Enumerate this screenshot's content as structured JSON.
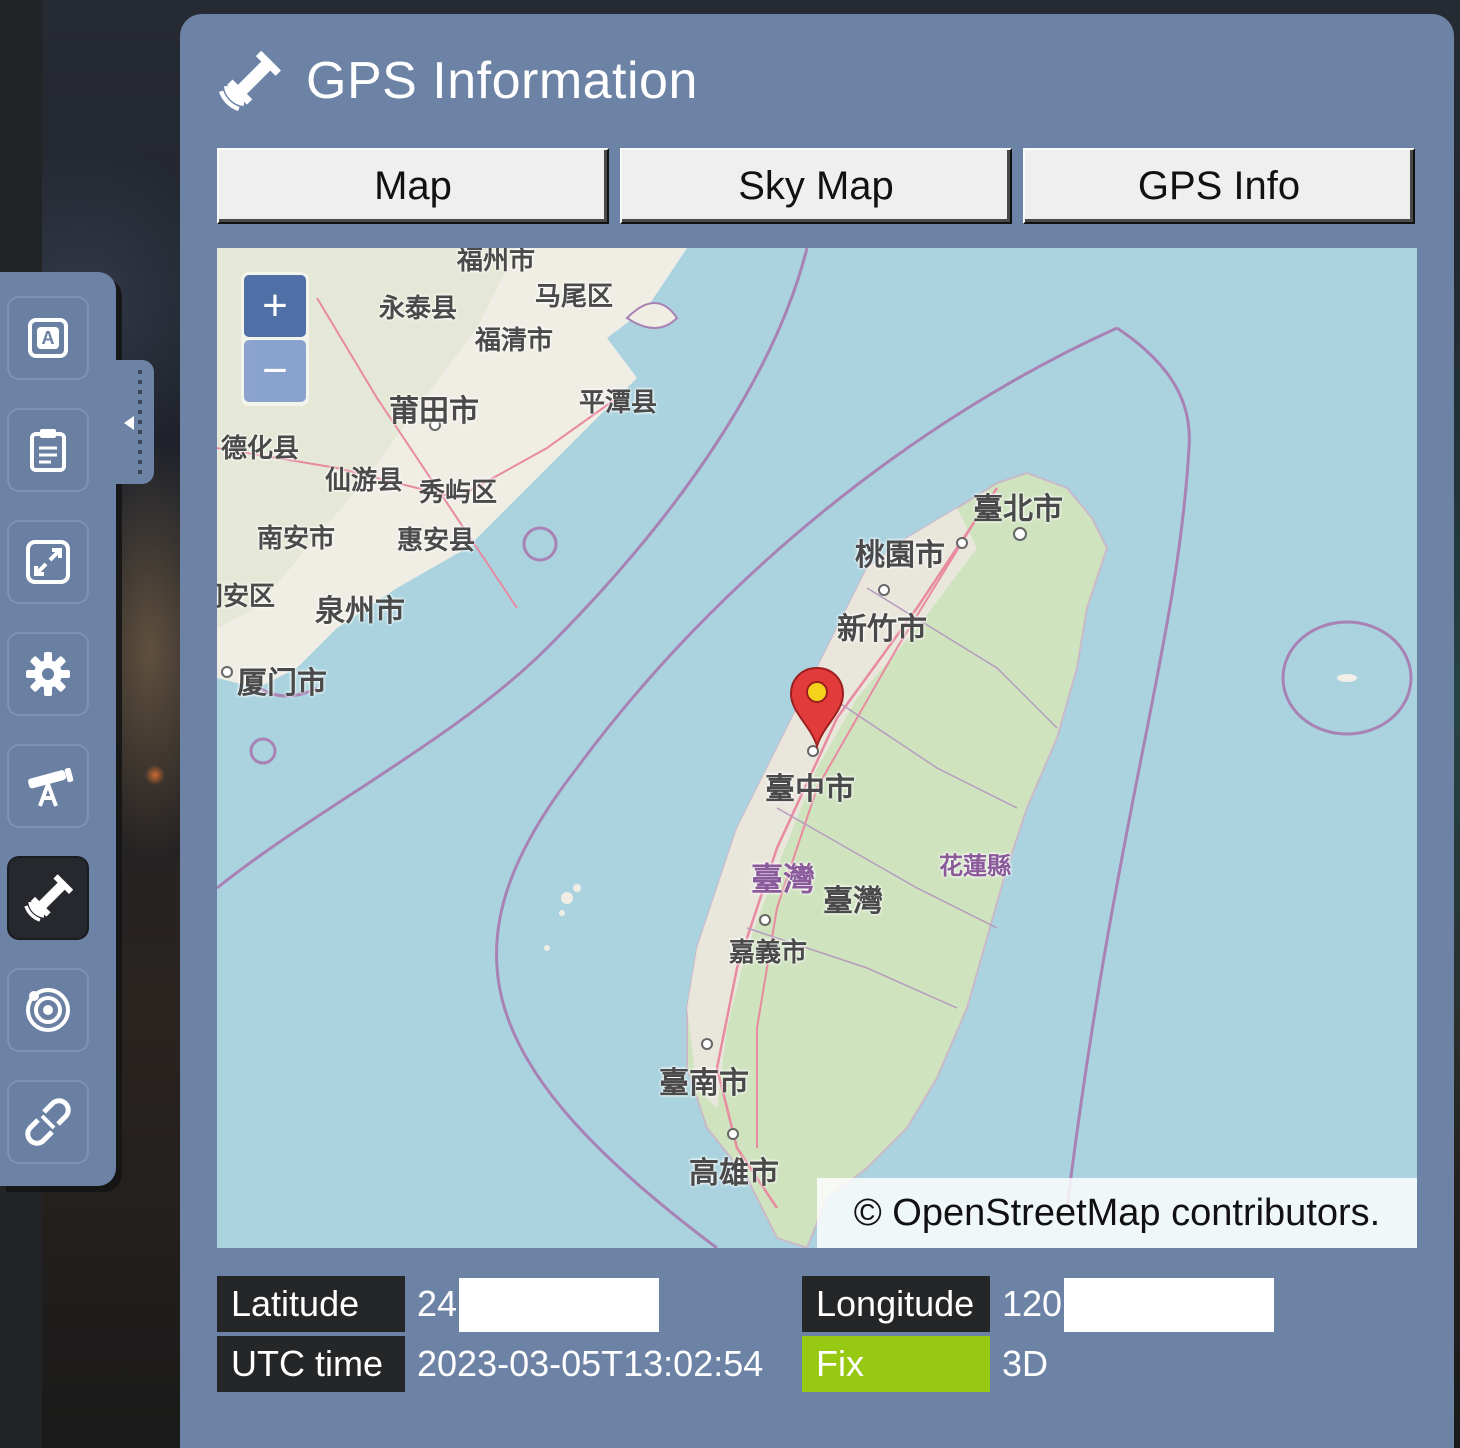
{
  "panel": {
    "title": "GPS Information",
    "title_icon": "satellite-icon"
  },
  "tabs": [
    {
      "label": "Map"
    },
    {
      "label": "Sky Map"
    },
    {
      "label": "GPS Info"
    }
  ],
  "toolbar": {
    "items": [
      {
        "name": "app-icon"
      },
      {
        "name": "clipboard-icon"
      },
      {
        "name": "fullscreen-icon"
      },
      {
        "name": "gear-icon"
      },
      {
        "name": "telescope-icon"
      },
      {
        "name": "satellite-icon",
        "active": true
      },
      {
        "name": "orbit-icon"
      },
      {
        "name": "disconnect-icon"
      }
    ]
  },
  "map": {
    "zoom_in": "+",
    "zoom_out": "−",
    "attribution": "© OpenStreetMap contributors.",
    "marker_icon": "map-pin-icon",
    "labels": {
      "fuzhou": "福州市",
      "mawei": "马尾区",
      "yongtai": "永泰县",
      "fuqing": "福清市",
      "putian": "莆田市",
      "pingtan": "平潭县",
      "dehua": "德化县",
      "xianyou": "仙游县",
      "xiuyu": "秀屿区",
      "nanan": "南安市",
      "huian": "惠安县",
      "tongan": "同安区",
      "quanzhou": "泉州市",
      "xiamen": "厦门市",
      "taipei": "臺北市",
      "taoyuan": "桃園市",
      "hsinchu": "新竹市",
      "taichung": "臺中市",
      "taiwan1": "臺灣",
      "taiwan2": "臺灣",
      "hualien": "花蓮縣",
      "chiayi": "嘉義市",
      "tainan": "臺南市",
      "kaohsiung": "高雄市"
    }
  },
  "info": {
    "latitude_label": "Latitude",
    "latitude_value": "24",
    "longitude_label": "Longitude",
    "longitude_value": "120",
    "utc_label": "UTC time",
    "utc_value": "2023-03-05T13:02:54",
    "fix_label": "Fix",
    "fix_value": "3D",
    "fix_color": "#98c912"
  }
}
